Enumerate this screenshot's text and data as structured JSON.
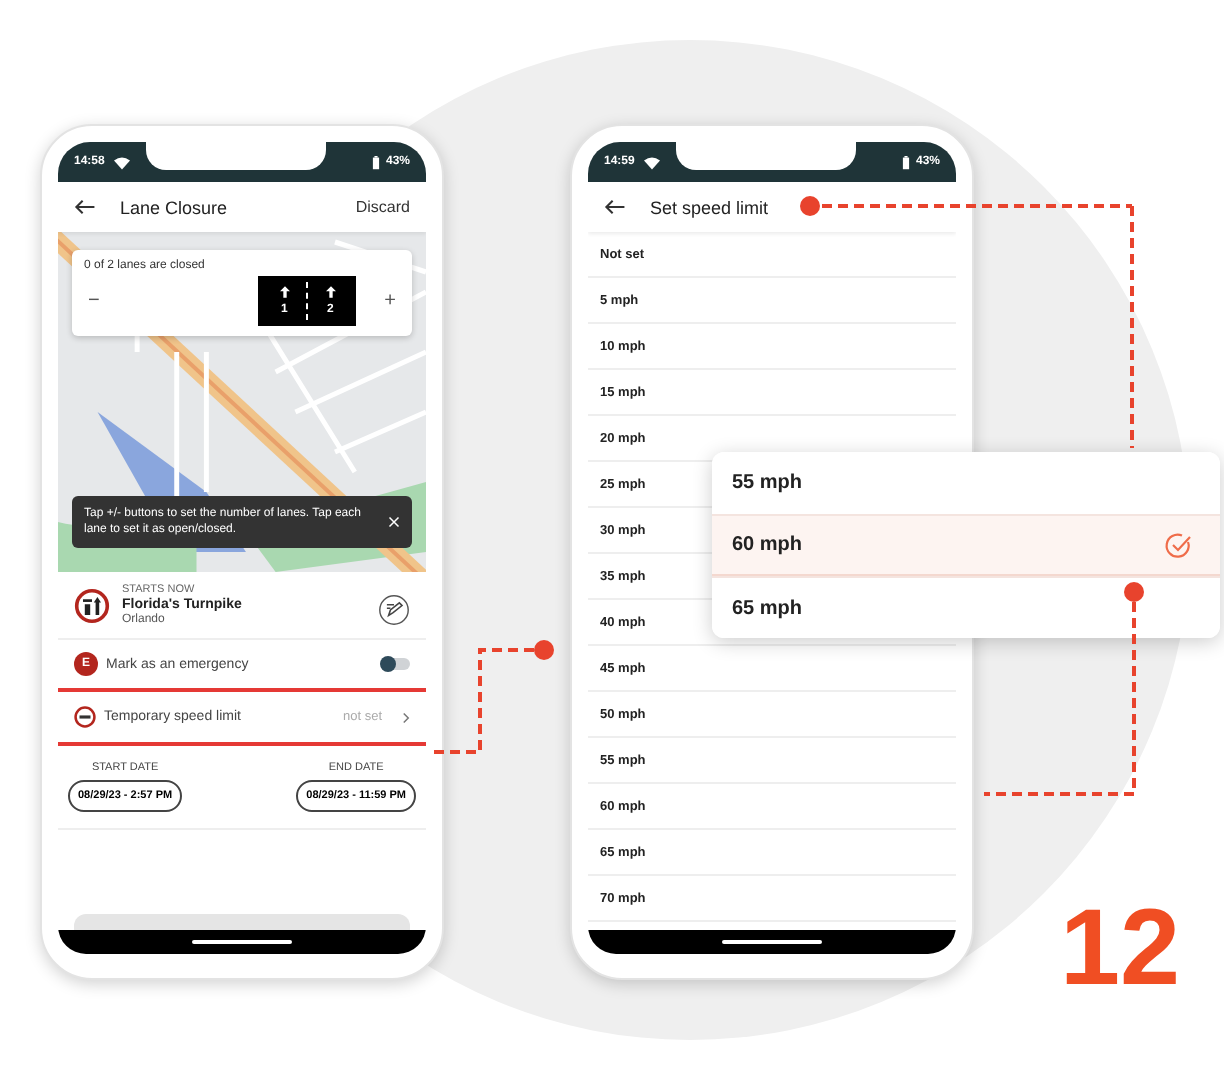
{
  "lane_closure_screen": {
    "status_bar": {
      "time": "14:58",
      "battery": "43%"
    },
    "header": {
      "title": "Lane Closure",
      "action": "Discard"
    },
    "lanes_card": {
      "summary": "0 of 2 lanes are closed",
      "minus": "−",
      "plus": "+",
      "lanes": [
        {
          "number": "1",
          "closed": false
        },
        {
          "number": "2",
          "closed": false
        }
      ]
    },
    "toast": {
      "message": "Tap +/- buttons to set the number of lanes. Tap each lane to set it as open/closed."
    },
    "location": {
      "starts": "STARTS NOW",
      "road": "Florida's Turnpike",
      "city": "Orlando"
    },
    "emergency": {
      "badge": "E",
      "label": "Mark as an emergency",
      "on": false
    },
    "speed_limit": {
      "label": "Temporary speed limit",
      "value": "not set",
      "highlighted": true
    },
    "dates": [
      {
        "label": "START DATE",
        "value": "08/29/23 - 2:57 PM"
      },
      {
        "label": "END DATE",
        "value": "08/29/23 - 11:59 PM"
      }
    ]
  },
  "speed_limit_screen": {
    "status_bar": {
      "time": "14:59",
      "battery": "43%"
    },
    "header": {
      "title": "Set speed limit"
    },
    "options": [
      "Not set",
      "5 mph",
      "10 mph",
      "15 mph",
      "20 mph",
      "25 mph",
      "30 mph",
      "35 mph",
      "40 mph",
      "45 mph",
      "50 mph",
      "55 mph",
      "60 mph",
      "65 mph",
      "70 mph"
    ]
  },
  "popup": {
    "options": [
      {
        "label": "55 mph",
        "selected": false
      },
      {
        "label": "60 mph",
        "selected": true
      },
      {
        "label": "65 mph",
        "selected": false
      }
    ]
  },
  "step_number": "12"
}
